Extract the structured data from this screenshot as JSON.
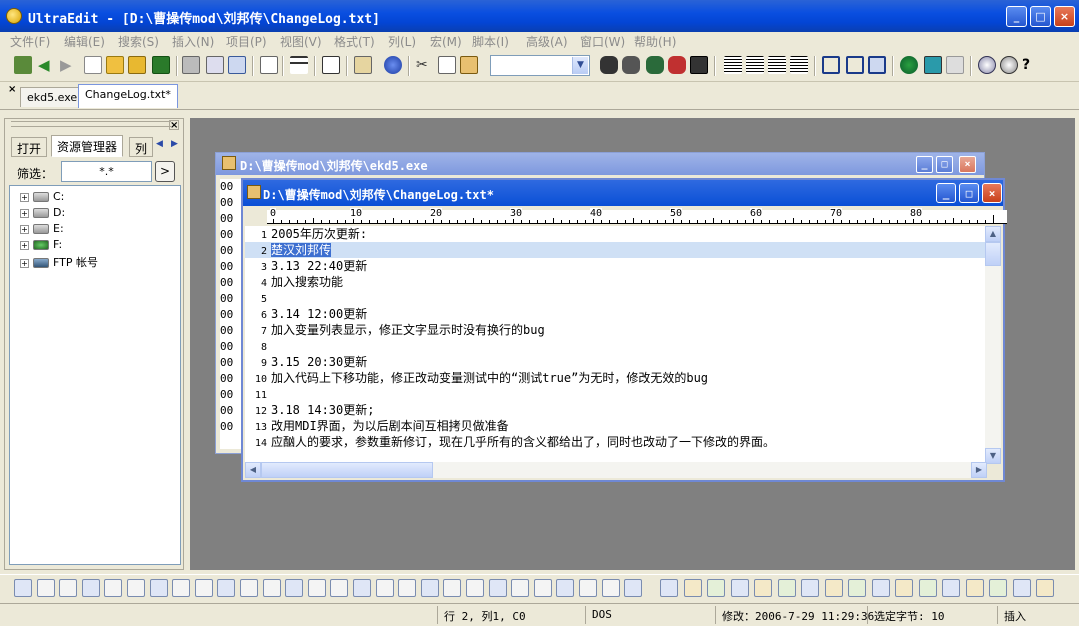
{
  "app": {
    "title": "UltraEdit - [D:\\曹操传mod\\刘邦传\\ChangeLog.txt]",
    "window_buttons": [
      "_",
      "□",
      "×"
    ]
  },
  "menu": [
    "文件(F)",
    "编辑(E)",
    "搜索(S)",
    "插入(N)",
    "项目(P)",
    "视图(V)",
    "格式(T)",
    "列(L)",
    "宏(M)",
    "脚本(I)",
    "高级(A)",
    "窗口(W)",
    "帮助(H)"
  ],
  "file_tabs": [
    "ekd5.exe",
    "ChangeLog.txt*"
  ],
  "side_panel": {
    "tabs": [
      "打开",
      "资源管理器",
      "列"
    ],
    "filter_label": "筛选：",
    "filter_value": "*.*",
    "go_label": ">",
    "tree": [
      "C:",
      "D:",
      "E:",
      "F:",
      "FTP 帐号"
    ]
  },
  "windows": {
    "exe_title": "D:\\曹操传mod\\刘邦传\\ekd5.exe",
    "exe_gutter": [
      "00",
      "00",
      "00",
      "00",
      "00",
      "00",
      "00",
      "00",
      "00",
      "00",
      "00",
      "00",
      "00",
      "00",
      "00",
      "00"
    ],
    "log_title": "D:\\曹操传mod\\刘邦传\\ChangeLog.txt*"
  },
  "ruler": [
    "0",
    "10",
    "20",
    "30",
    "40",
    "50",
    "60",
    "70",
    "80"
  ],
  "lines": [
    {
      "n": "1",
      "text": "2005年历次更新:"
    },
    {
      "n": "2",
      "text": "楚汉刘邦传"
    },
    {
      "n": "3",
      "text": "3.13 22:40更新"
    },
    {
      "n": "4",
      "text": "加入搜索功能"
    },
    {
      "n": "5",
      "text": ""
    },
    {
      "n": "6",
      "text": "3.14 12:00更新"
    },
    {
      "n": "7",
      "text": "加入变量列表显示，修正文字显示时没有换行的bug"
    },
    {
      "n": "8",
      "text": ""
    },
    {
      "n": "9",
      "text": "3.15 20:30更新"
    },
    {
      "n": "10",
      "text": "加入代码上下移功能，修正改动变量测试中的“测试true”为无时，修改无效的bug"
    },
    {
      "n": "11",
      "text": ""
    },
    {
      "n": "12",
      "text": "3.18 14:30更新;"
    },
    {
      "n": "13",
      "text": "改用MDI界面，为以后剧本间互相拷贝做准备"
    },
    {
      "n": "14",
      "text": "应酗人的要求，参数重新修订，现在几乎所有的含义都给出了，同时也改动了一下修改的界面。"
    }
  ],
  "status": {
    "position": "行 2, 列1, C0",
    "format": "DOS",
    "modified": "修改：2006-7-29 11:29:36",
    "selected": "选定字节: 10",
    "mode": "插入"
  },
  "colors": {
    "title": "#0a4fe0",
    "selection": "#3d6fd0",
    "mdi_bg": "#808080"
  }
}
